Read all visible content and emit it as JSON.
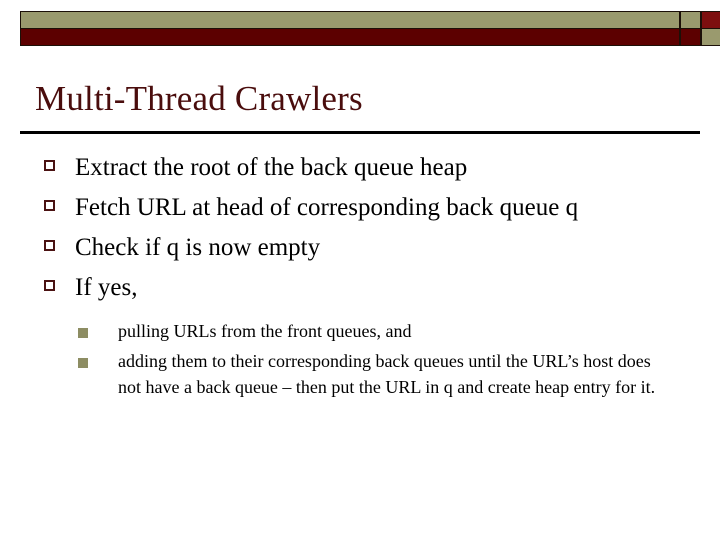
{
  "slide": {
    "title": "Multi-Thread Crawlers",
    "banner": {
      "olive_color": "#9a9a6e",
      "maroon_color": "#5c0000",
      "accent_square_color": "#7d0f0f"
    },
    "title_color": "#4a0d0d",
    "bullets": [
      {
        "text": "Extract the root of the back queue heap"
      },
      {
        "text": "Fetch URL at head of corresponding back queue q"
      },
      {
        "text": "Check if q is now empty"
      },
      {
        "text": "If yes,"
      }
    ],
    "sub_bullets": [
      {
        "text": "pulling URLs from the front queues, and"
      },
      {
        "text": "adding them to their corresponding back queues until the URL’s host does not have a back queue – then put the URL in q and create heap entry for it."
      }
    ]
  }
}
